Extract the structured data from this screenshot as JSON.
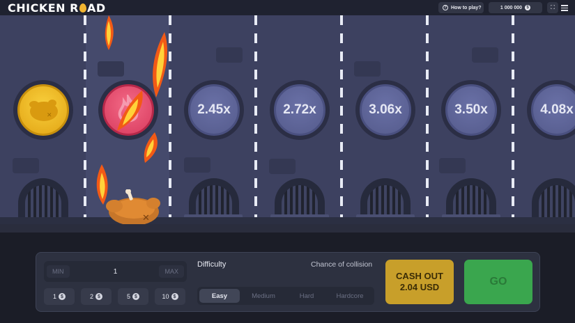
{
  "header": {
    "logo_part1": "CHICKEN R",
    "logo_part2": "AD",
    "how_to_play": "How to play?",
    "balance": "1 000 000",
    "currency_icon": "dollar-coin-icon"
  },
  "road": {
    "lanes": [
      {
        "state": "passed",
        "label": ""
      },
      {
        "state": "burned",
        "label": ""
      },
      {
        "state": "upcoming",
        "label": "2.45x"
      },
      {
        "state": "upcoming",
        "label": "2.72x"
      },
      {
        "state": "upcoming",
        "label": "3.06x"
      },
      {
        "state": "upcoming",
        "label": "3.50x"
      },
      {
        "state": "upcoming",
        "label": "4.08x"
      }
    ]
  },
  "controls": {
    "bet": {
      "min_label": "MIN",
      "value": "1",
      "max_label": "MAX"
    },
    "quick_bets": [
      "1",
      "2",
      "5",
      "10"
    ],
    "difficulty_label": "Difficulty",
    "chance_label": "Chance of collision",
    "difficulties": [
      "Easy",
      "Medium",
      "Hard",
      "Hardcore"
    ],
    "selected_difficulty": "Easy",
    "cash_out_line1": "CASH OUT",
    "cash_out_line2": "2.04 USD",
    "go_label": "GO"
  },
  "colors": {
    "road": "#3d4160",
    "gold_coin": "#f2b531",
    "fire_coin": "#e0456a",
    "cash_out": "#c89f2a",
    "go": "#3aa64e"
  }
}
